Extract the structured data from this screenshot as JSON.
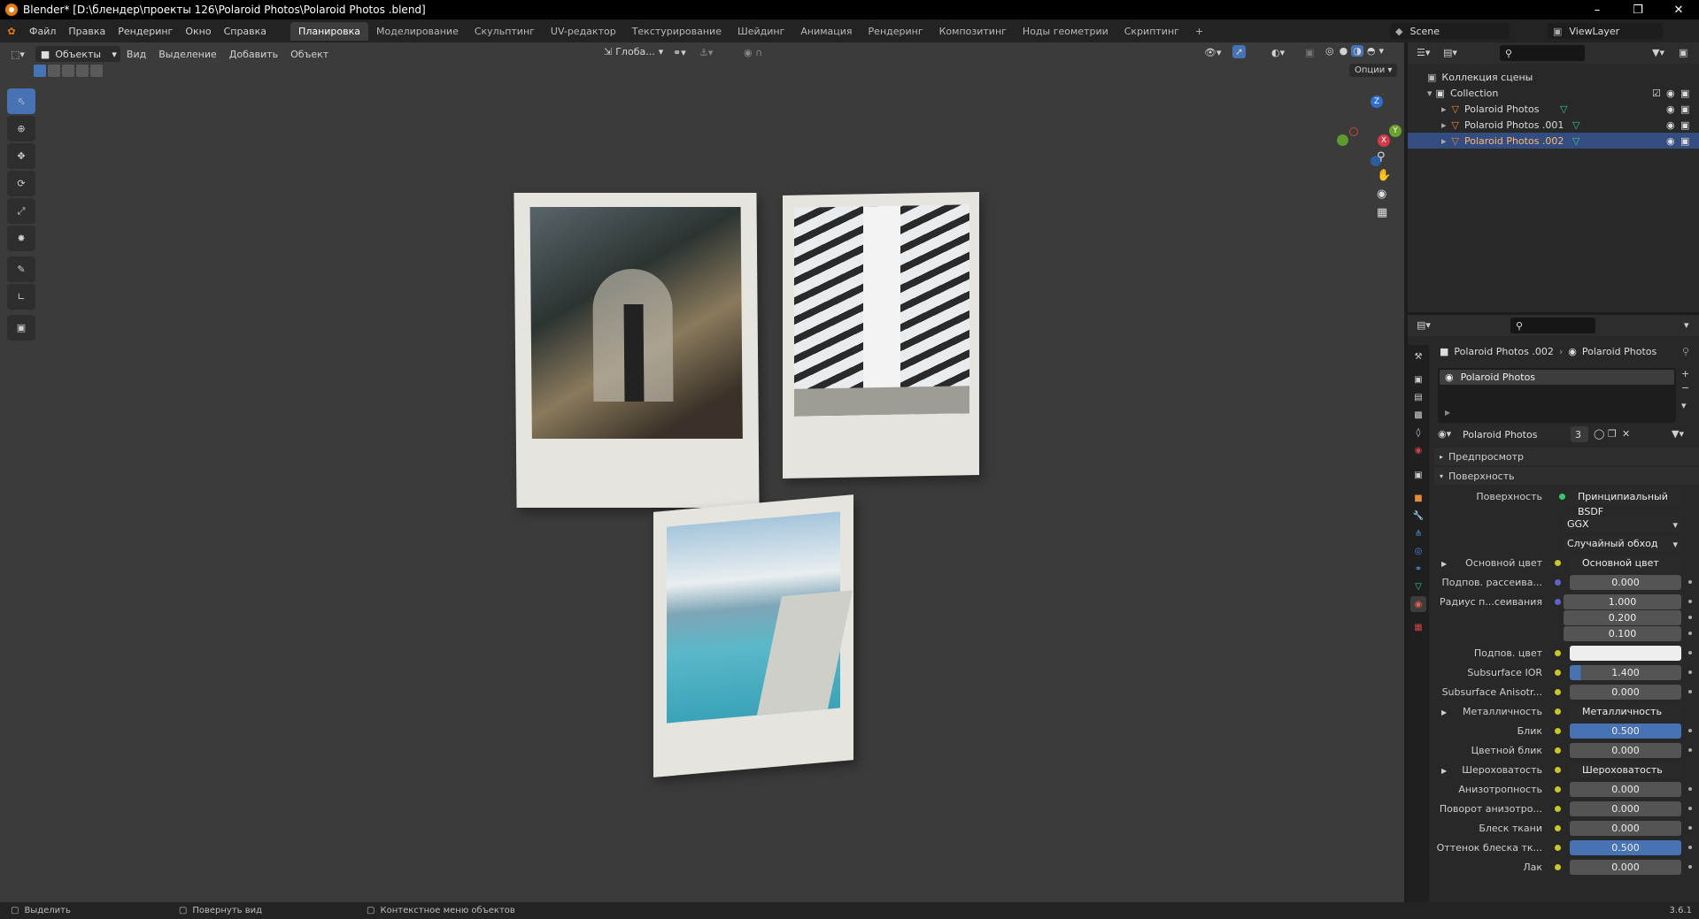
{
  "window": {
    "title": "Blender* [D:\\блендер\\проекты 126\\Polaroid Photos\\Polaroid Photos .blend]"
  },
  "menu": [
    "Файл",
    "Правка",
    "Рендеринг",
    "Окно",
    "Справка"
  ],
  "workspaces": [
    "Планировка",
    "Моделирование",
    "Скульптинг",
    "UV-редактор",
    "Текстурирование",
    "Шейдинг",
    "Анимация",
    "Рендеринг",
    "Композитинг",
    "Ноды геометрии",
    "Скриптинг",
    "+"
  ],
  "scene": {
    "scene_name": "Scene",
    "view_layer": "ViewLayer"
  },
  "viewport": {
    "mode": "Объекты",
    "menus": [
      "Вид",
      "Выделение",
      "Добавить",
      "Объект"
    ],
    "transform_orientation": "Глоба...",
    "options_label": "Опции",
    "gizmo_labels": [
      "Z",
      "Y",
      "X"
    ]
  },
  "outliner": {
    "root": "Коллекция сцены",
    "collection": "Collection",
    "objects": [
      "Polaroid Photos",
      "Polaroid Photos .001",
      "Polaroid Photos .002"
    ]
  },
  "properties": {
    "breadcrumb_object": "Polaroid Photos .002",
    "breadcrumb_material": "Polaroid Photos",
    "slot_name": "Polaroid Photos",
    "material_name": "Polaroid Photos",
    "users": "3",
    "panel_preview": "Предпросмотр",
    "panel_surface": "Поверхность",
    "surface_label": "Поверхность",
    "surface_value": "Принципиальный BSDF",
    "distribution": "GGX",
    "subsurface_method": "Случайный обход",
    "rows": [
      {
        "label": "Основной цвет",
        "value": "Основной цвет",
        "type": "link"
      },
      {
        "label": "Подпов. рассеива...",
        "value": "0.000",
        "type": "num"
      },
      {
        "label": "Радиус п...сеивания",
        "value": "1.000",
        "type": "vec"
      },
      {
        "label": "",
        "value": "0.200",
        "type": "vec"
      },
      {
        "label": "",
        "value": "0.100",
        "type": "vec"
      },
      {
        "label": "Подпов. цвет",
        "value": "",
        "type": "color"
      },
      {
        "label": "Subsurface IOR",
        "value": "1.400",
        "type": "slider",
        "fill": 0.1
      },
      {
        "label": "Subsurface Anisotr...",
        "value": "0.000",
        "type": "num"
      },
      {
        "label": "Металличность",
        "value": "Металличность",
        "type": "link"
      },
      {
        "label": "Блик",
        "value": "0.500",
        "type": "blue"
      },
      {
        "label": "Цветной блик",
        "value": "0.000",
        "type": "num"
      },
      {
        "label": "Шероховатость",
        "value": "Шероховатость",
        "type": "link"
      },
      {
        "label": "Анизотропность",
        "value": "0.000",
        "type": "num"
      },
      {
        "label": "Поворот анизотро...",
        "value": "0.000",
        "type": "num"
      },
      {
        "label": "Блеск ткани",
        "value": "0.000",
        "type": "num"
      },
      {
        "label": "Оттенок блеска тк...",
        "value": "0.500",
        "type": "blue"
      },
      {
        "label": "Лак",
        "value": "0.000",
        "type": "num"
      }
    ]
  },
  "statusbar": {
    "select": "Выделить",
    "rotate": "Повернуть вид",
    "context": "Контекстное меню объектов",
    "version": "3.6.1"
  },
  "colors": {
    "accent": "#4772b3",
    "selection": "#334d80",
    "viewport_bg": "#3b3b3b"
  }
}
